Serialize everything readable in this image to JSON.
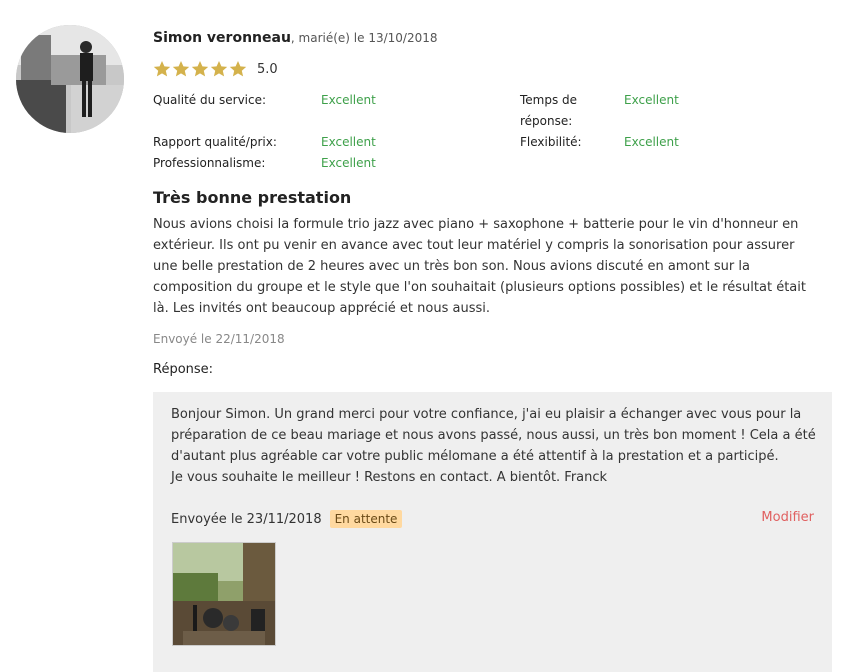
{
  "reviewer": {
    "name": "Simon veronneau",
    "meta": ", marié(e) le 13/10/2018"
  },
  "rating": {
    "score": "5.0",
    "stars_filled": 5,
    "star_color": "#d4b24c"
  },
  "criteria": [
    {
      "label": "Qualité du service:",
      "value": "Excellent"
    },
    {
      "label": "Temps de réponse:",
      "value": "Excellent"
    },
    {
      "label": "Rapport qualité/prix:",
      "value": "Excellent"
    },
    {
      "label": "Flexibilité:",
      "value": "Excellent"
    },
    {
      "label": "Professionnalisme:",
      "value": "Excellent"
    }
  ],
  "review": {
    "title": "Très bonne prestation",
    "body": "Nous avions choisi la formule trio jazz avec piano + saxophone + batterie pour le vin d'honneur en extérieur. Ils ont pu venir en avance avec tout leur matériel y compris la sonorisation pour assurer une belle prestation de 2 heures avec un très bon son. Nous avions discuté en amont sur la composition du groupe et le style que l'on souhaitait (plusieurs options possibles) et le résultat était là. Les invités ont beaucoup apprécié et nous aussi.",
    "sent": "Envoyé le 22/11/2018"
  },
  "response": {
    "label": "Réponse:",
    "lines": [
      "Bonjour Simon. Un grand merci pour votre confiance, j'ai eu plaisir a échanger avec vous pour la",
      "préparation de ce beau mariage et nous avons passé, nous aussi, un très bon moment ! Cela a été",
      "d'autant plus agréable car votre public mélomane a été attentif à la prestation et a participé.",
      "Je vous souhaite le meilleur ! Restons en contact. A bientôt. Franck"
    ],
    "sent": "Envoyée le 23/11/2018",
    "status": "En attente",
    "modify_label": "Modifier"
  },
  "colors": {
    "accent_green": "#3ea04a",
    "modify_red": "#e06060",
    "badge_bg": "#ffd9a0",
    "response_bg": "#efefef"
  }
}
